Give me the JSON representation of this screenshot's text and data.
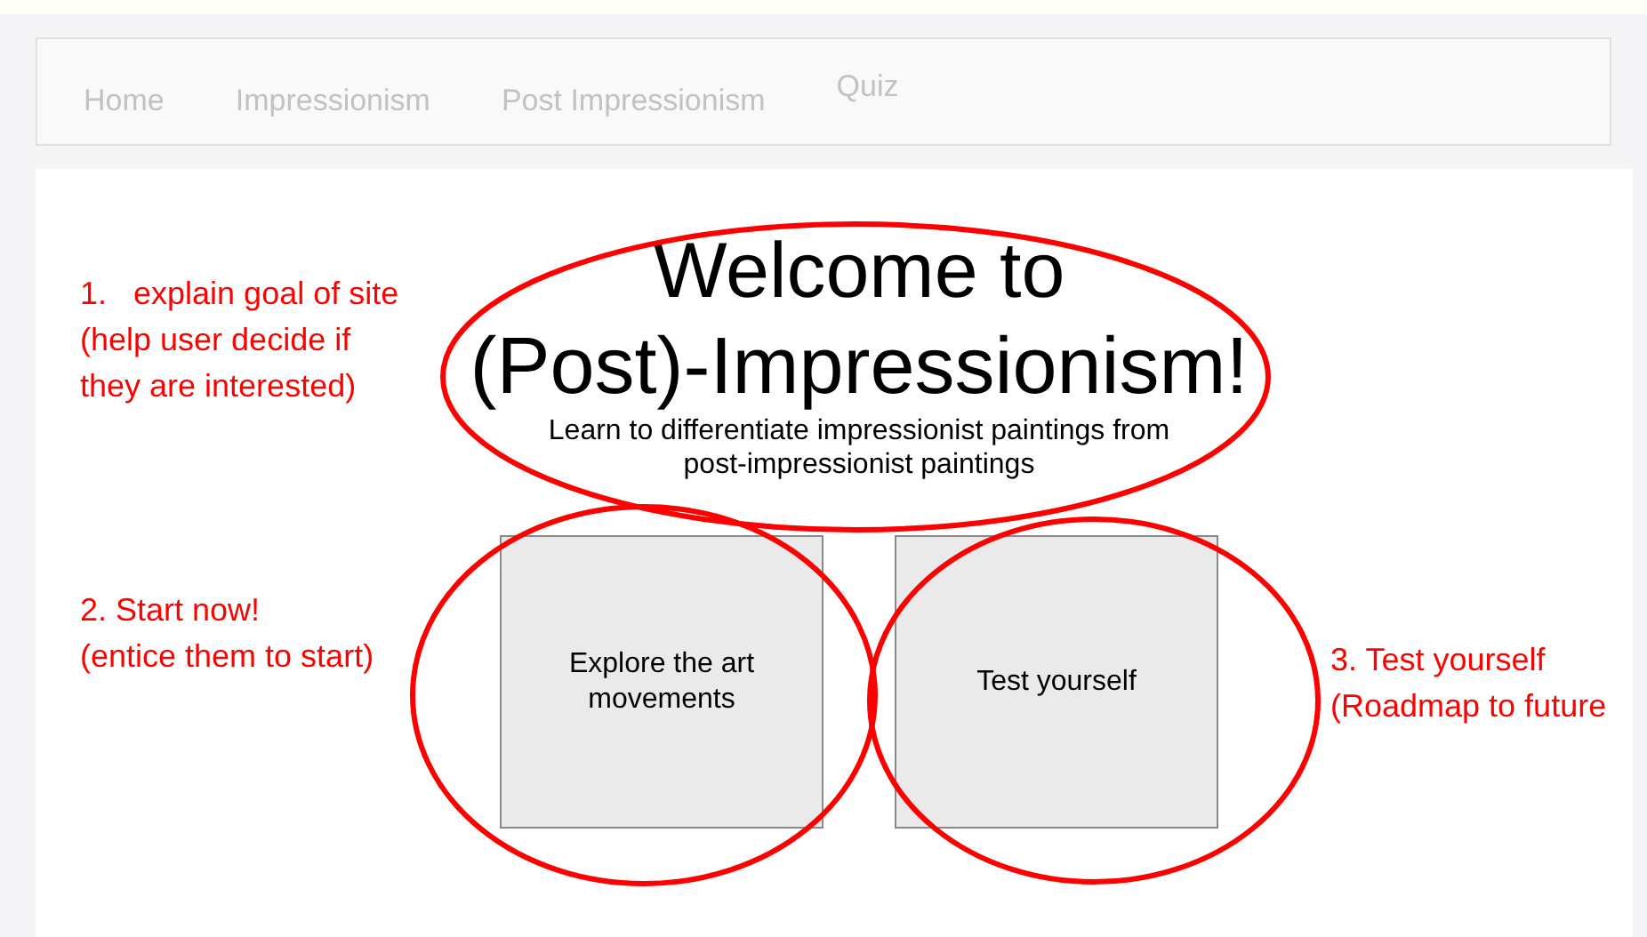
{
  "nav": {
    "items": [
      "Home",
      "Impressionism",
      "Post Impressionism",
      "Quiz"
    ]
  },
  "hero": {
    "title_lines": [
      "Welcome to",
      "(Post)-Impressionism!"
    ],
    "subtitle": "Learn to differentiate impressionist paintings from post-impressionist paintings"
  },
  "cards": [
    "Explore the art movements",
    "Test yourself"
  ],
  "annotations": [
    {
      "heading": "1.   explain goal of site",
      "note": "(help user decide if they are interested)"
    },
    {
      "heading": "2. Start now!",
      "note": "(entice them to start)"
    },
    {
      "heading": "3. Test yourself",
      "note": "(Roadmap to future"
    }
  ]
}
